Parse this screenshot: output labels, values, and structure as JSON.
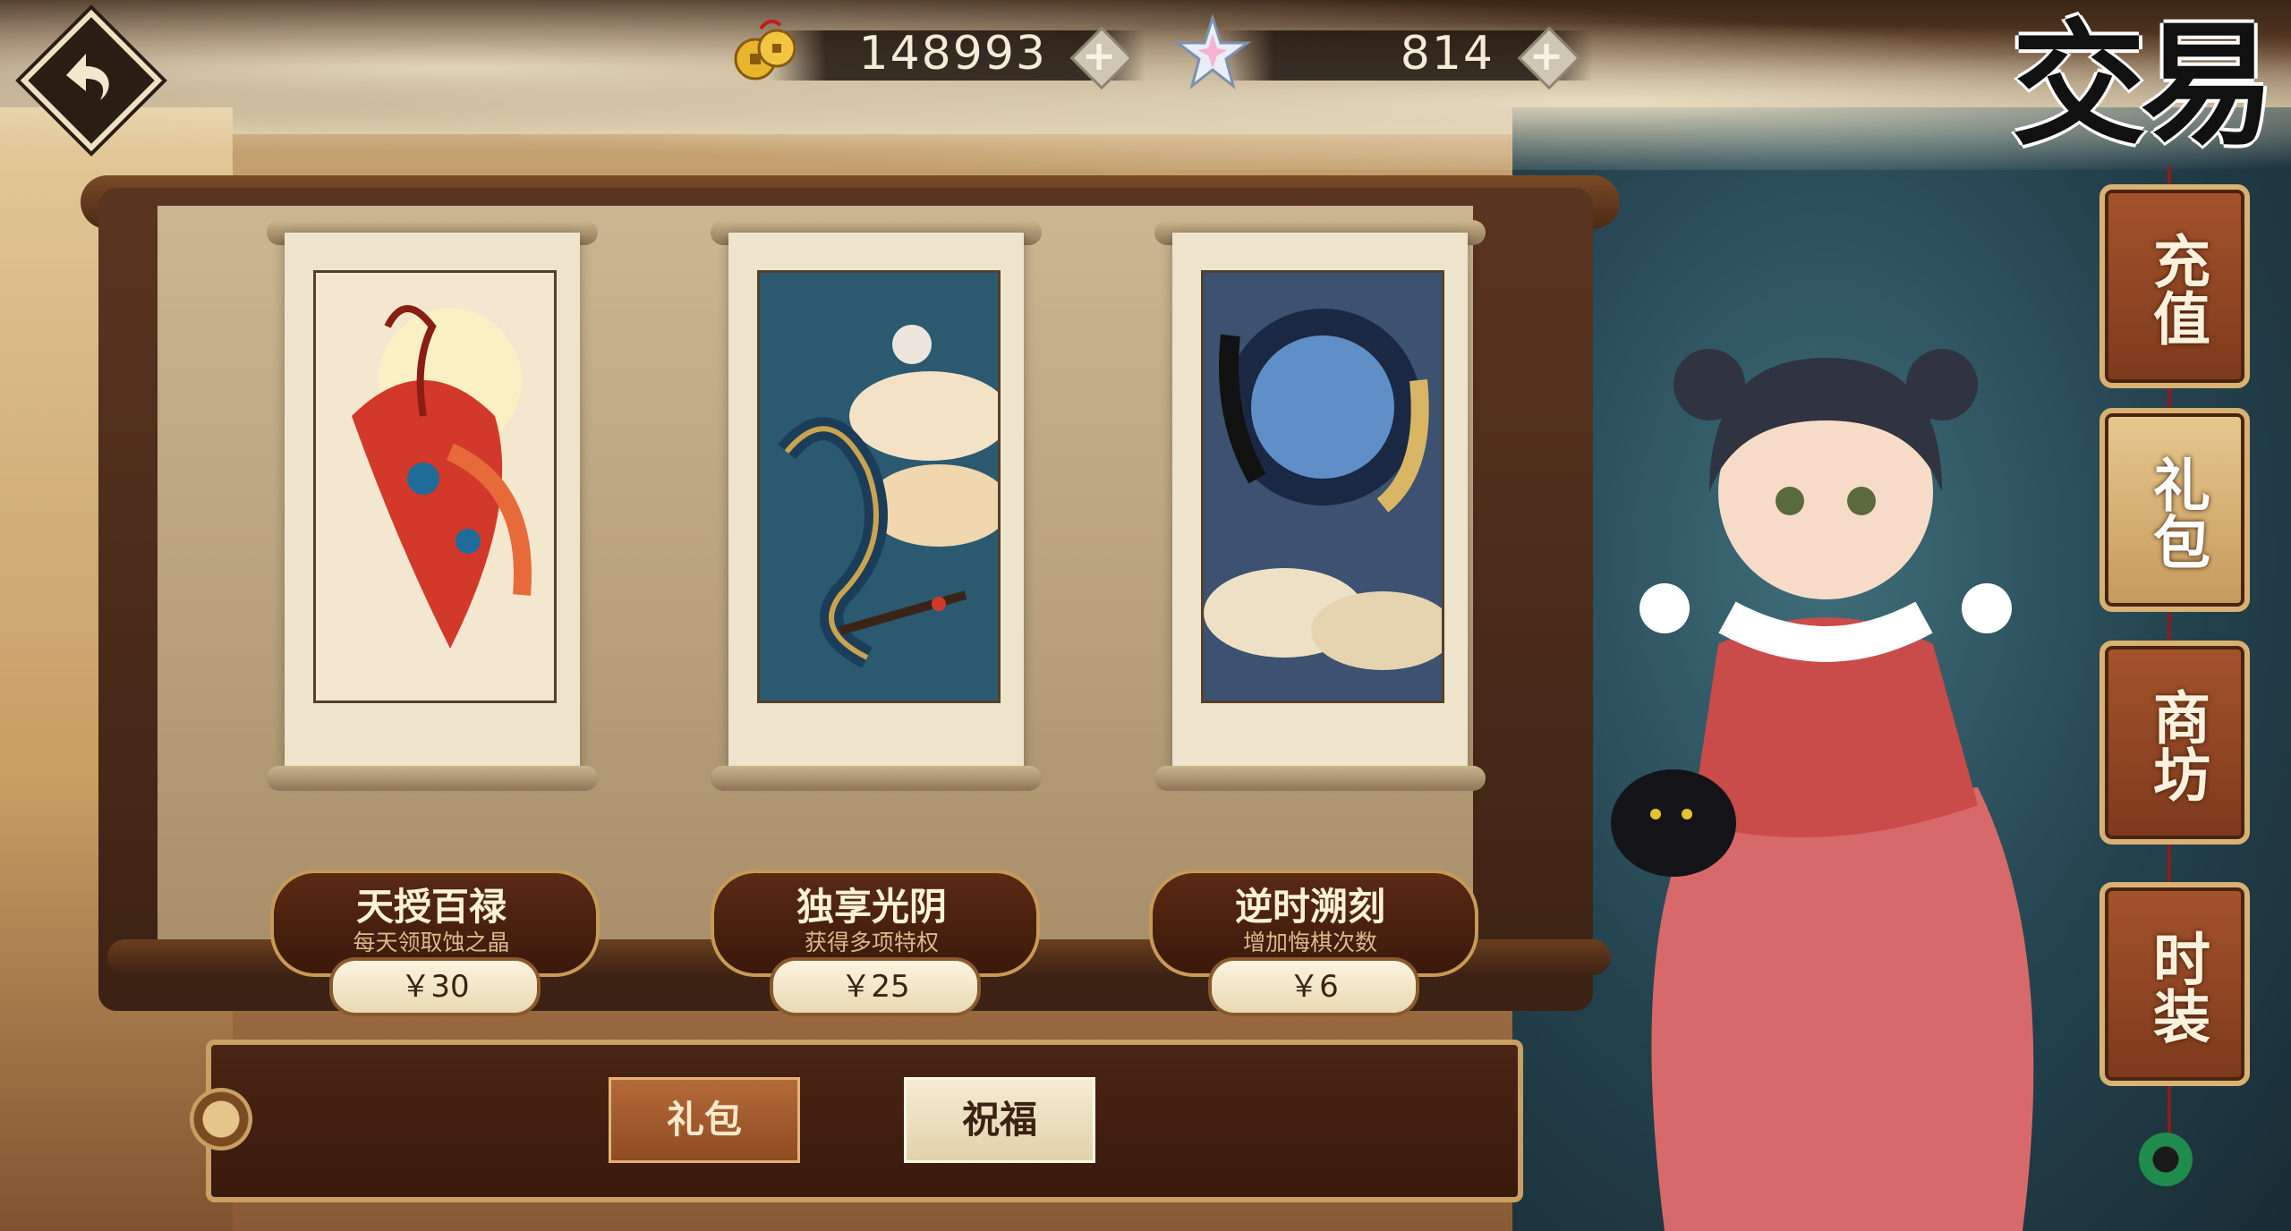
{
  "screen": {
    "title": "交易"
  },
  "currency": {
    "coins": {
      "icon": "copper-coin-icon",
      "value": "148993"
    },
    "crystals": {
      "icon": "crystal-icon",
      "value": "814"
    },
    "plus_symbol": "+"
  },
  "side_tabs": [
    {
      "label": "充值",
      "active": false
    },
    {
      "label": "礼包",
      "active": true
    },
    {
      "label": "商坊",
      "active": false
    },
    {
      "label": "时装",
      "active": false
    }
  ],
  "gifts": [
    {
      "name": "天授百禄",
      "desc": "每天领取蚀之晶",
      "price": "￥30",
      "art": "phoenix"
    },
    {
      "name": "独享光阴",
      "desc": "获得多项特权",
      "price": "￥25",
      "art": "dragon"
    },
    {
      "name": "逆时溯刻",
      "desc": "增加悔棋次数",
      "price": "￥6",
      "art": "moon-koi"
    }
  ],
  "bottom_tabs": {
    "gift": "礼包",
    "bless": "祝福"
  },
  "colors": {
    "accent": "#c9a063",
    "dark_wood": "#3a1a0c",
    "paper": "#eee4cc"
  }
}
